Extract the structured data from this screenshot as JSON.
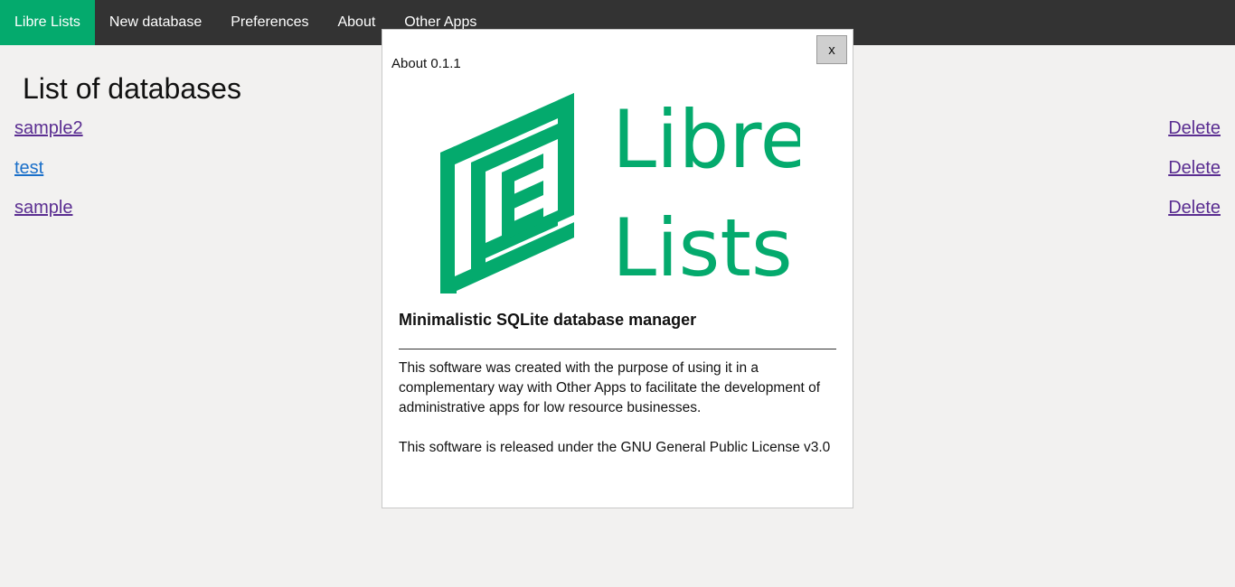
{
  "nav": {
    "items": [
      "Libre Lists",
      "New database",
      "Preferences",
      "About",
      "Other Apps"
    ]
  },
  "main": {
    "title": "List of databases",
    "databases": [
      {
        "name": "sample2",
        "action": "Delete"
      },
      {
        "name": "test",
        "action": "Delete"
      },
      {
        "name": "sample",
        "action": "Delete"
      }
    ]
  },
  "modal": {
    "title": "About 0.1.1",
    "close_label": "x",
    "logo_text_line1": "Libre",
    "logo_text_line2": "Lists",
    "tagline": "Minimalistic SQLite database manager",
    "description": "This software was created with the purpose of using it in a complementary way with Other Apps to facilitate the development of administrative apps for low resource businesses.",
    "license": "This software is released under the GNU General Public License v3.0"
  },
  "colors": {
    "brand": "#04aa6d",
    "navbar": "#333333",
    "link": "#5a2d91",
    "background": "#f2f1f0"
  }
}
